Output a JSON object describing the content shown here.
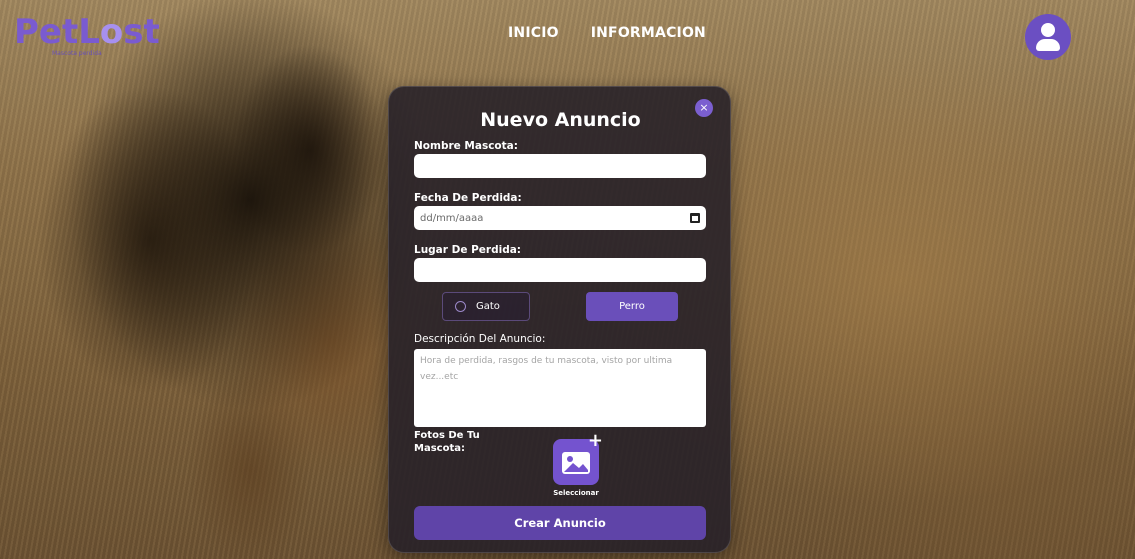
{
  "brand": {
    "logo_text_a": "Pet",
    "logo_text_b": "L",
    "logo_text_c": "o",
    "logo_text_d": "st",
    "logo_tagline": "Mascota perdida"
  },
  "nav": {
    "items": [
      "INICIO",
      "INFORMACION"
    ]
  },
  "modal": {
    "title": "Nuevo Anuncio",
    "close_label": "×",
    "fields": {
      "pet_name": {
        "label": "Nombre Mascota:",
        "value": ""
      },
      "lost_date": {
        "label": "Fecha De Perdida:",
        "placeholder": "dd/mm/aaaa"
      },
      "lost_place": {
        "label": "Lugar De Perdida:",
        "value": ""
      }
    },
    "pet_type": {
      "options": [
        "Gato",
        "Perro"
      ],
      "selected": "Perro"
    },
    "description": {
      "label": "Descripción Del Anuncio:",
      "placeholder": "Hora de perdida, rasgos de tu mascota, visto por ultima vez...etc"
    },
    "photos": {
      "label": "Fotos De Tu Mascota:",
      "button_caption": "Seleccionar"
    },
    "submit_label": "Crear Anuncio"
  },
  "colors": {
    "accent": "#6a4fba",
    "accent_dark": "#5f44a8",
    "modal_bg": "#262028"
  }
}
